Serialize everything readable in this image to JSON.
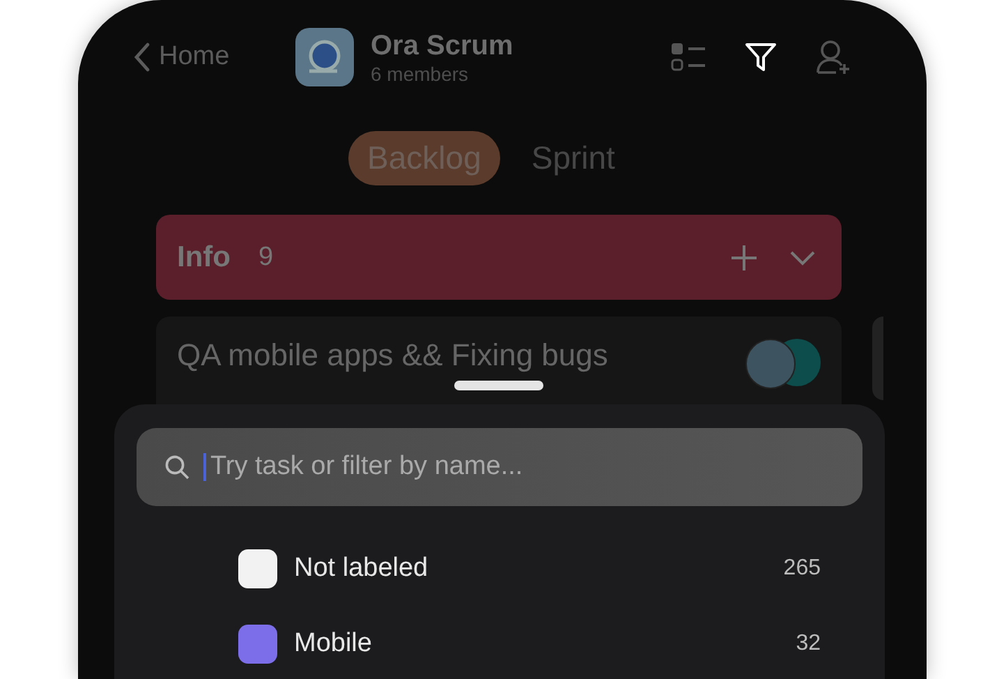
{
  "header": {
    "back": "Home",
    "title": "Ora Scrum",
    "subtitle": "6 members"
  },
  "tabs": [
    {
      "label": "Backlog",
      "selected": true
    },
    {
      "label": "Sprint",
      "selected": false
    }
  ],
  "list": {
    "title": "Info",
    "count": "9",
    "color": "#5a1f2a"
  },
  "task": {
    "title": "QA mobile apps && Fixing bugs"
  },
  "search": {
    "placeholder": "Try task or filter by name..."
  },
  "labels": [
    {
      "name": "Not labeled",
      "count": "265",
      "color": "#f2f2f2"
    },
    {
      "name": "Mobile",
      "count": "32",
      "color": "#7b6ee8"
    }
  ]
}
